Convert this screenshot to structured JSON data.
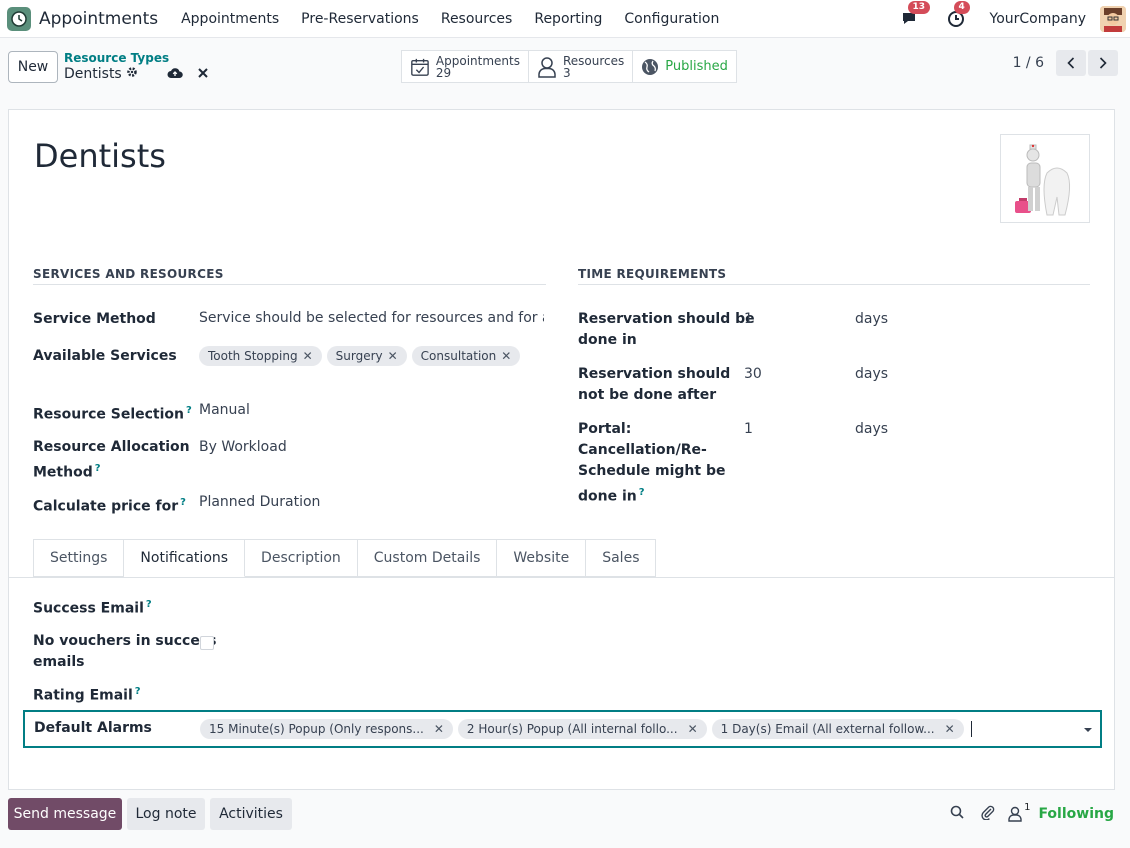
{
  "nav": {
    "app_name": "Appointments",
    "menu": [
      "Appointments",
      "Pre-Reservations",
      "Resources",
      "Reporting",
      "Configuration"
    ],
    "messages_badge": "13",
    "activities_badge": "4",
    "company": "YourCompany"
  },
  "control": {
    "new_label": "New",
    "breadcrumb_parent": "Resource Types",
    "breadcrumb_current": "Dentists",
    "smart_buttons": {
      "appointments_label": "Appointments",
      "appointments_count": "29",
      "resources_label": "Resources",
      "resources_count": "3",
      "published_label": "Published"
    },
    "pager": "1 / 6"
  },
  "form": {
    "title": "Dentists",
    "services_section": "SERVICES AND RESOURCES",
    "time_section": "TIME REQUIREMENTS",
    "service_method_label": "Service Method",
    "service_method_value": "Service should be selected for resources and for app",
    "available_services_label": "Available Services",
    "available_services": [
      "Tooth Stopping",
      "Surgery",
      "Consultation"
    ],
    "resource_selection_label": "Resource Selection",
    "resource_selection_value": "Manual",
    "allocation_label_1": "Resource Allocation",
    "allocation_label_2": "Method",
    "allocation_value": "By Workload",
    "price_label": "Calculate price for",
    "price_value": "Planned Duration",
    "res_done_in_1": "Reservation should be",
    "res_done_in_2": "done in",
    "res_done_in_value": "1",
    "res_not_after_1": "Reservation should",
    "res_not_after_2": "not be done after",
    "res_not_after_value": "30",
    "portal_1": "Portal:",
    "portal_2": "Cancellation/Re-",
    "portal_3": "Schedule might be",
    "portal_4": "done in",
    "portal_value": "1",
    "days_unit": "days",
    "help_mark": "?"
  },
  "tabs": [
    "Settings",
    "Notifications",
    "Description",
    "Custom Details",
    "Website",
    "Sales"
  ],
  "notifications": {
    "success_email_label": "Success Email",
    "no_vouchers_1": "No vouchers in success",
    "no_vouchers_2": "emails",
    "rating_email_label": "Rating Email",
    "default_alarms_label": "Default Alarms",
    "alarms": [
      "15 Minute(s) Popup (Only respons...",
      "2 Hour(s) Popup (All internal follo...",
      "1 Day(s) Email (All external follow..."
    ]
  },
  "chatter": {
    "send_message": "Send message",
    "log_note": "Log note",
    "activities": "Activities",
    "followers_count": "1",
    "following": "Following"
  },
  "colors": {
    "primary": "#714b67",
    "accent": "#017e84",
    "success": "#28a745",
    "badge": "#d44c59"
  }
}
